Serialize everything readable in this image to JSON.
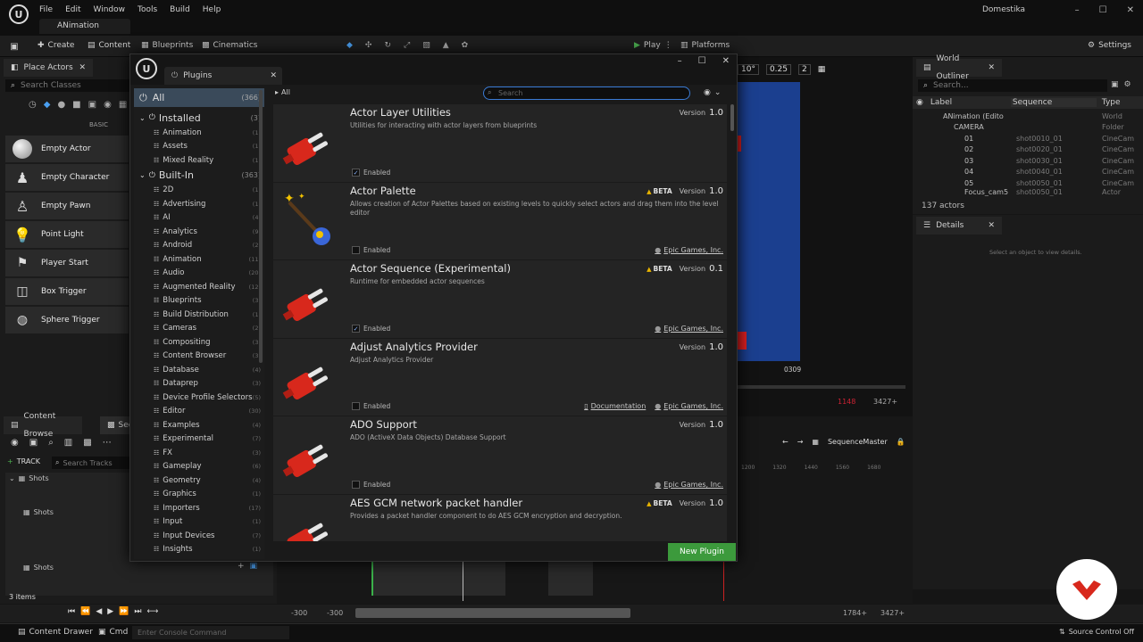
{
  "menu": [
    "File",
    "Edit",
    "Window",
    "Tools",
    "Build",
    "Help"
  ],
  "app_tab": "ANimation",
  "project": "Domestika",
  "toolbar": {
    "create": "Create",
    "content": "Content",
    "blueprints": "Blueprints",
    "cinematics": "Cinematics",
    "play": "Play",
    "platforms": "Platforms",
    "settings": "Settings"
  },
  "place_actors": {
    "tab": "Place Actors",
    "search_placeholder": "Search Classes",
    "basic_label": "BASIC",
    "items": [
      "Empty Actor",
      "Empty Character",
      "Empty Pawn",
      "Point Light",
      "Player Start",
      "Box Trigger",
      "Sphere Trigger"
    ]
  },
  "sequencer": {
    "tab1": "Content Browse",
    "tab2": "Sequ",
    "track_label": "TRACK",
    "search_placeholder": "Search Tracks",
    "rows": [
      "Shots",
      "Shots",
      "Shots"
    ],
    "items_count": "3 items"
  },
  "viewport": {
    "fov": "10°",
    "speed": "0.25",
    "cams": "2",
    "frame": "0309",
    "frame_a": "1148",
    "frame_b": "3427+"
  },
  "timeline": {
    "breadcrumb": "SequenceMaster",
    "ticks": [
      "1200",
      "1320",
      "1440",
      "1560",
      "1680"
    ],
    "start_a": "-300",
    "start_b": "-300",
    "end_a": "1784+",
    "end_b": "3427+"
  },
  "outliner": {
    "tab": "World Outliner",
    "search_placeholder": "Search...",
    "cols": [
      "Label",
      "Sequence",
      "Type"
    ],
    "rows": [
      {
        "label": "ANimation (Edito",
        "sequence": "",
        "type": "World"
      },
      {
        "label": "CAMERA",
        "sequence": "",
        "type": "Folder"
      },
      {
        "label": "01",
        "sequence": "shot0010_01",
        "type": "CineCam"
      },
      {
        "label": "02",
        "sequence": "shot0020_01",
        "type": "CineCam"
      },
      {
        "label": "03",
        "sequence": "shot0030_01",
        "type": "CineCam"
      },
      {
        "label": "04",
        "sequence": "shot0040_01",
        "type": "CineCam"
      },
      {
        "label": "05",
        "sequence": "shot0050_01",
        "type": "CineCam"
      },
      {
        "label": "Focus_cam5",
        "sequence": "shot0050_01",
        "type": "Actor"
      }
    ],
    "count": "137 actors"
  },
  "details": {
    "tab": "Details",
    "hint": "Select an object to view details."
  },
  "plugins": {
    "tab": "Plugins",
    "search_placeholder": "Search",
    "breadcrumb": "All",
    "all": {
      "label": "All",
      "count": "(366)"
    },
    "installed": {
      "label": "Installed",
      "count": "(3)"
    },
    "installed_items": [
      {
        "label": "Animation",
        "count": "(1)"
      },
      {
        "label": "Assets",
        "count": "(1)"
      },
      {
        "label": "Mixed Reality",
        "count": "(1)"
      }
    ],
    "builtin": {
      "label": "Built-In",
      "count": "(363)"
    },
    "builtin_items": [
      {
        "label": "2D",
        "count": "(1)"
      },
      {
        "label": "Advertising",
        "count": "(1)"
      },
      {
        "label": "AI",
        "count": "(4)"
      },
      {
        "label": "Analytics",
        "count": "(9)"
      },
      {
        "label": "Android",
        "count": "(2)"
      },
      {
        "label": "Animation",
        "count": "(11)"
      },
      {
        "label": "Audio",
        "count": "(20)"
      },
      {
        "label": "Augmented Reality",
        "count": "(12)"
      },
      {
        "label": "Blueprints",
        "count": "(3)"
      },
      {
        "label": "Build Distribution",
        "count": "(1)"
      },
      {
        "label": "Cameras",
        "count": "(2)"
      },
      {
        "label": "Compositing",
        "count": "(3)"
      },
      {
        "label": "Content Browser",
        "count": "(3)"
      },
      {
        "label": "Database",
        "count": "(4)"
      },
      {
        "label": "Dataprep",
        "count": "(3)"
      },
      {
        "label": "Device Profile Selectors",
        "count": "(5)"
      },
      {
        "label": "Editor",
        "count": "(30)"
      },
      {
        "label": "Examples",
        "count": "(4)"
      },
      {
        "label": "Experimental",
        "count": "(7)"
      },
      {
        "label": "FX",
        "count": "(3)"
      },
      {
        "label": "Gameplay",
        "count": "(6)"
      },
      {
        "label": "Geometry",
        "count": "(4)"
      },
      {
        "label": "Graphics",
        "count": "(1)"
      },
      {
        "label": "Importers",
        "count": "(17)"
      },
      {
        "label": "Input",
        "count": "(1)"
      },
      {
        "label": "Input Devices",
        "count": "(7)"
      },
      {
        "label": "Insights",
        "count": "(1)"
      }
    ],
    "list": [
      {
        "name": "Actor Layer Utilities",
        "desc": "Utilities for interacting with actor layers from blueprints",
        "beta": "",
        "ver_label": "Version",
        "ver": "1.0",
        "enabled": "Enabled",
        "checked": true,
        "docs": "",
        "author": "",
        "icon": "plug"
      },
      {
        "name": "Actor Palette",
        "desc": "Allows creation of Actor Palettes based on existing levels to quickly select actors and drag them into the level editor",
        "beta": "BETA",
        "ver_label": "Version",
        "ver": "1.0",
        "enabled": "Enabled",
        "checked": false,
        "docs": "",
        "author": "Epic Games, Inc.",
        "icon": "wand"
      },
      {
        "name": "Actor Sequence (Experimental)",
        "desc": "Runtime for embedded actor sequences",
        "beta": "BETA",
        "ver_label": "Version",
        "ver": "0.1",
        "enabled": "Enabled",
        "checked": true,
        "docs": "",
        "author": "Epic Games, Inc.",
        "icon": "plug"
      },
      {
        "name": "Adjust Analytics Provider",
        "desc": "Adjust Analytics Provider",
        "beta": "",
        "ver_label": "Version",
        "ver": "1.0",
        "enabled": "Enabled",
        "checked": false,
        "docs": "Documentation",
        "author": "Epic Games, Inc.",
        "icon": "plug"
      },
      {
        "name": "ADO Support",
        "desc": "ADO (ActiveX Data Objects) Database Support",
        "beta": "",
        "ver_label": "Version",
        "ver": "1.0",
        "enabled": "Enabled",
        "checked": false,
        "docs": "",
        "author": "Epic Games, Inc.",
        "icon": "plug"
      },
      {
        "name": "AES GCM network packet handler",
        "desc": "Provides a packet handler component to do AES GCM encryption and decryption.",
        "beta": "BETA",
        "ver_label": "Version",
        "ver": "1.0",
        "enabled": "Enabled",
        "checked": false,
        "docs": "",
        "author": "",
        "icon": "plug"
      }
    ],
    "new_plugin": "New Plugin"
  },
  "status": {
    "content_drawer": "Content Drawer",
    "cmd": "Cmd",
    "console_placeholder": "Enter Console Command",
    "source_control": "Source Control Off"
  },
  "colors": {
    "accent": "#3a7bd5",
    "new_plugin": "#3c9a3c",
    "beta": "#e8b400",
    "plug_red": "#d8281c"
  }
}
